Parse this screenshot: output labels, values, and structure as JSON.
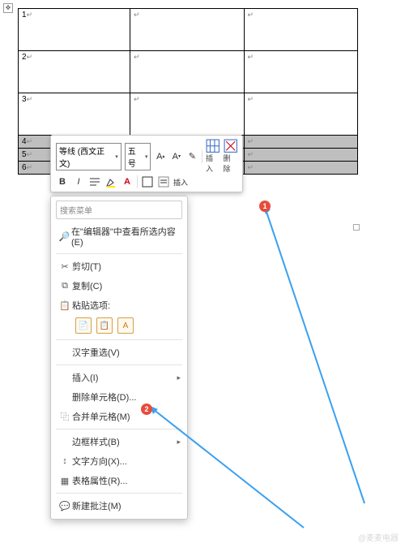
{
  "table": {
    "rows": [
      "1",
      "2",
      "3",
      "4",
      "5",
      "6"
    ],
    "mark": "↵"
  },
  "mini": {
    "font": "等线 (西文正文)",
    "size": "五号",
    "bold": "B",
    "italic": "I",
    "insert": "插入",
    "delete": "删除"
  },
  "menu": {
    "search": "搜索菜单",
    "lookup": "在\"编辑器\"中查看所选内容(E)",
    "cut": "剪切(T)",
    "copy": "复制(C)",
    "paste_opt": "粘贴选项:",
    "hanzi": "汉字重选(V)",
    "insert": "插入(I)",
    "delcell": "删除单元格(D)...",
    "merge": "合并单元格(M)",
    "border": "边框样式(B)",
    "textdir": "文字方向(X)...",
    "tblprop": "表格属性(R)...",
    "comment": "新建批注(M)"
  },
  "badges": {
    "one": "1",
    "two": "2"
  },
  "watermark": "@麦麦电器"
}
